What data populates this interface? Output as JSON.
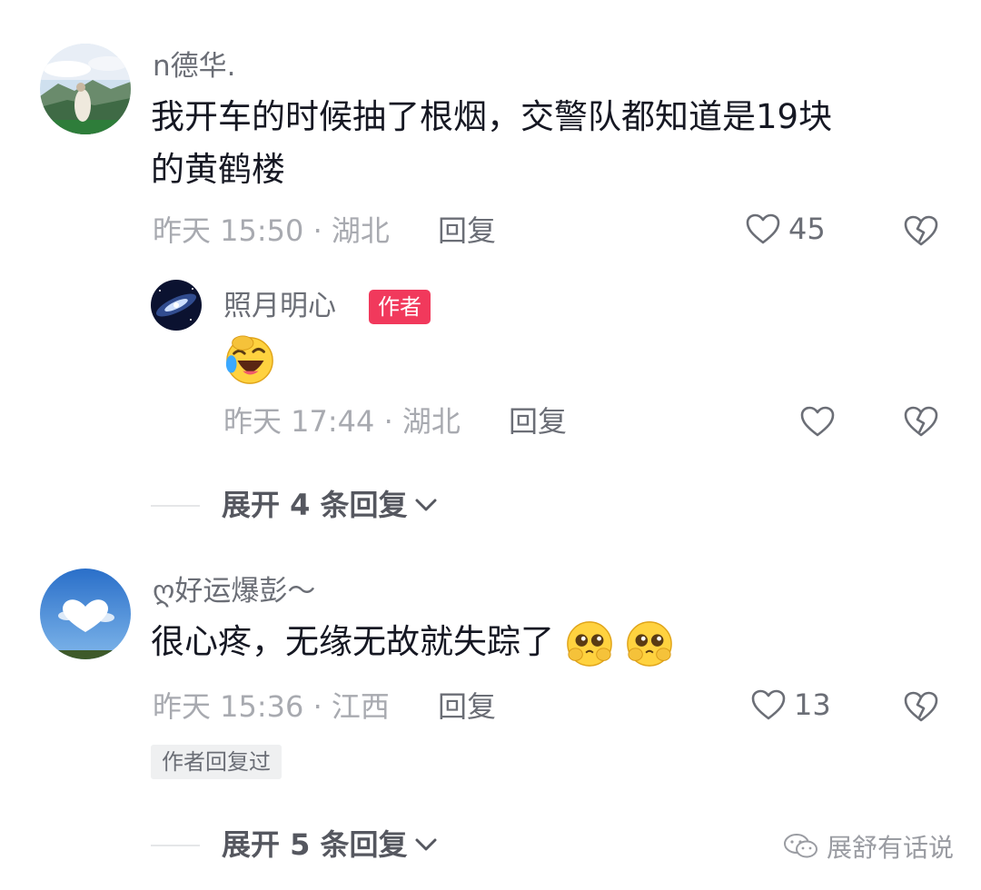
{
  "comments": [
    {
      "username": "n德华.",
      "text_line1": "我开车的时候抽了根烟，交警队都知道是19块",
      "text_line2": "的黄鹤楼",
      "meta": "昨天 15:50 · 湖北",
      "reply_label": "回复",
      "likes": "45",
      "avatar_icon": "landscape-person"
    },
    {
      "username": "ღ好运爆彭～",
      "text": "很心疼，无缘无故就失踪了",
      "emojis": [
        "pleading-face",
        "pleading-face"
      ],
      "meta": "昨天 15:36 · 江西",
      "reply_label": "回复",
      "likes": "13",
      "author_replied": "作者回复过",
      "avatar_icon": "heart-cloud"
    }
  ],
  "reply": {
    "username": "照月明心",
    "badge": "作者",
    "emoji": "laughing-crying-face",
    "meta": "昨天 17:44 · 湖北",
    "reply_label": "回复",
    "avatar_icon": "galaxy"
  },
  "expand1": "展开 4 条回复",
  "expand2": "展开 5 条回复",
  "watermark": "展舒有话说",
  "colors": {
    "badge": "#f1395c",
    "primary_text": "#161823",
    "secondary_text": "#a8aab0"
  }
}
